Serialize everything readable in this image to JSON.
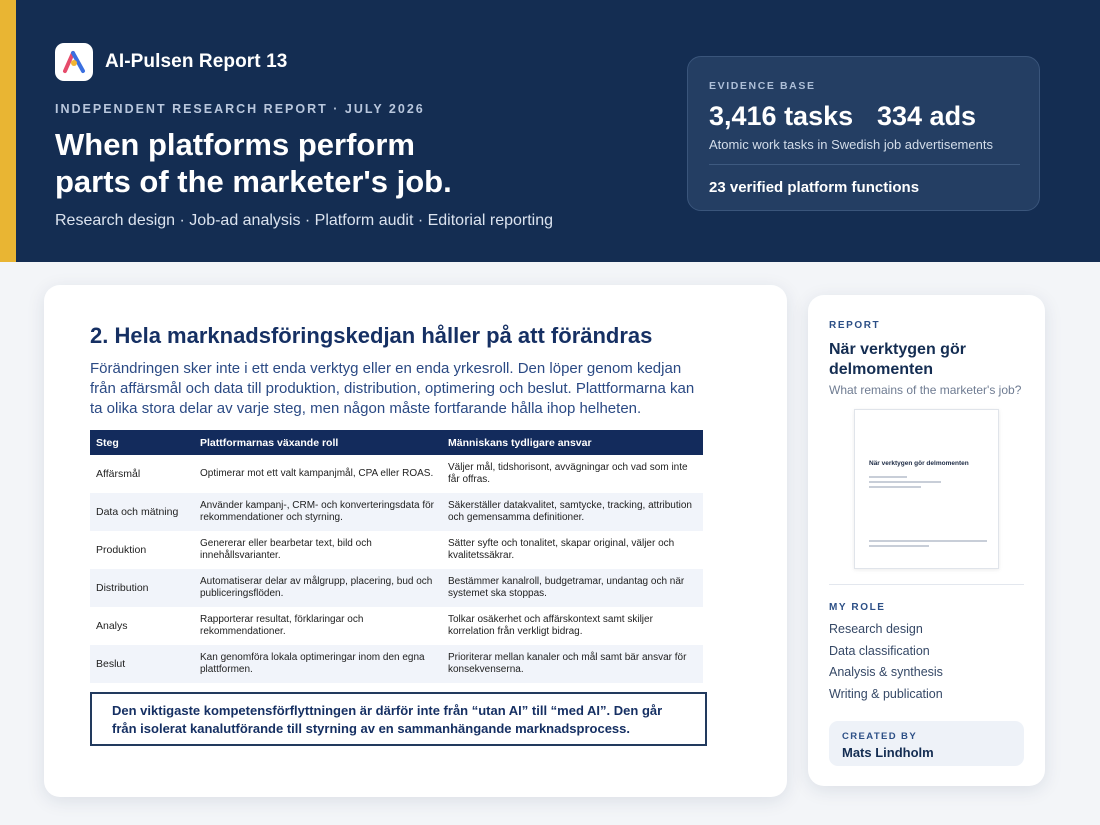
{
  "header": {
    "brand_name": "AI-Pulsen Report 13",
    "kicker": "INDEPENDENT RESEARCH REPORT · JULY 2026",
    "headline_line1": "When platforms perform",
    "headline_line2": "parts of the marketer's job.",
    "subline": "Research design · Job-ad analysis · Platform audit · Editorial reporting",
    "accent_color": "#e9b533",
    "background_color": "#142d52"
  },
  "evidence": {
    "label": "EVIDENCE BASE",
    "tasks": "3,416 tasks",
    "ads": "334 ads",
    "description": "Atomic work tasks in Swedish job advertisements",
    "verified": "23 verified platform functions"
  },
  "document": {
    "title": "2. Hela marknadsföringskedjan håller på att förändras",
    "intro": "Förändringen sker inte i ett enda verktyg eller en enda yrkesroll. Den löper genom kedjan från affärsmål och data till produktion, distribution, optimering och beslut. Plattformarna kan ta olika stora delar av varje steg, men någon måste fortfarande hålla ihop helheten.",
    "table": {
      "headers": [
        "Steg",
        "Plattformarnas växande roll",
        "Människans tydligare ansvar"
      ],
      "rows": [
        [
          "Affärsmål",
          "Optimerar mot ett valt kampanjmål, CPA eller ROAS.",
          "Väljer mål, tidshorisont, avvägningar och vad som inte får offras."
        ],
        [
          "Data och mätning",
          "Använder kampanj-, CRM- och konverteringsdata för rekommendationer och styrning.",
          "Säkerställer datakvalitet, samtycke, tracking, attribution och gemensamma definitioner."
        ],
        [
          "Produktion",
          "Genererar eller bearbetar text, bild och innehållsvarianter.",
          "Sätter syfte och tonalitet, skapar original, väljer och kvalitetssäkrar."
        ],
        [
          "Distribution",
          "Automatiserar delar av målgrupp, placering, bud och publiceringsflöden.",
          "Bestämmer kanalroll, budgetramar, undantag och när systemet ska stoppas."
        ],
        [
          "Analys",
          "Rapporterar resultat, förklaringar och rekommendationer.",
          "Tolkar osäkerhet och affärskontext samt skiljer korrelation från verkligt bidrag."
        ],
        [
          "Beslut",
          "Kan genomföra lokala optimeringar inom den egna plattformen.",
          "Prioriterar mellan kanaler och mål samt bär ansvar för konsekvenserna."
        ]
      ]
    },
    "callout": "Den viktigaste kompetensförflyttningen är därför inte från “utan AI” till “med AI”. Den går från isolerat kanalutförande till styrning av en sammanhängande marknadsprocess."
  },
  "sidebar": {
    "report_label": "REPORT",
    "report_title": "När verktygen gör delmomenten",
    "report_subtitle": "What remains of the marketer's job?",
    "thumbnail_title": "När verktygen gör delmomenten",
    "role_label": "MY ROLE",
    "roles": [
      "Research design",
      "Data classification",
      "Analysis & synthesis",
      "Writing & publication"
    ],
    "created_label": "CREATED BY",
    "created_name": "Mats Lindholm"
  }
}
